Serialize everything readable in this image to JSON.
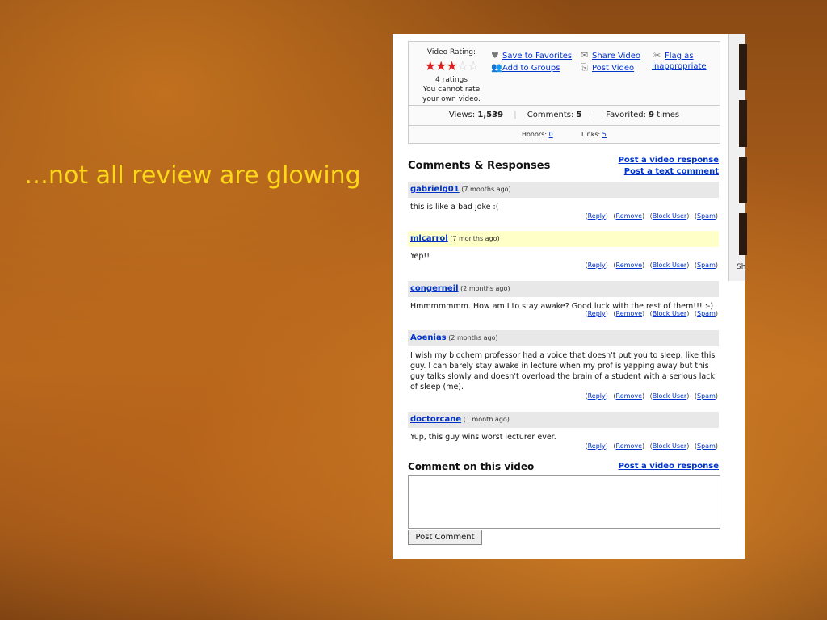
{
  "slide": {
    "caption": "…not all review are glowing"
  },
  "video_box": {
    "rating_label": "Video Rating:",
    "stars_filled": 3,
    "stars_total": 5,
    "ratings_count": "4 ratings",
    "rating_note": "You cannot rate your own video.",
    "actions": {
      "save_favorites": "Save to Favorites",
      "add_groups": "Add to Groups",
      "share_video": "Share Video",
      "post_video": "Post Video",
      "flag_as": "Flag as",
      "inappropriate": "Inappropriate"
    },
    "stats": {
      "views_label": "Views:",
      "views_value": "1,539",
      "comments_label": "Comments:",
      "comments_value": "5",
      "favorited_label": "Favorited:",
      "favorited_value": "9",
      "favorited_suffix": "times",
      "honors_label": "Honors:",
      "honors_value": "0",
      "links_label": "Links:",
      "links_value": "5"
    }
  },
  "comments_section": {
    "title": "Comments & Responses",
    "post_video_response": "Post a video response",
    "post_text_comment": "Post a text comment",
    "action_labels": {
      "reply": "Reply",
      "remove": "Remove",
      "block": "Block User",
      "spam": "Spam"
    },
    "comments": [
      {
        "user": "gabrielg01",
        "time": "(7 months ago)",
        "text": "this is like a bad joke :("
      },
      {
        "user": "mlcarrol",
        "time": "(7 months ago)",
        "text": "Yep!!"
      },
      {
        "user": "congerneil",
        "time": "(2 months ago)",
        "text": "Hmmmmmmm. How am I to stay awake? Good luck with the rest of them!!! :-)"
      },
      {
        "user": "Aoenias",
        "time": "(2 months ago)",
        "text": "I wish my biochem professor had a voice that doesn't put you to sleep, like this guy. I can barely stay awake in lecture when my prof is yapping away but this guy talks slowly and doesn't overload the brain of a student with a serious lack of sleep (me)."
      },
      {
        "user": "doctorcane",
        "time": "(1 month ago)",
        "text": "Yup, this guy wins worst lecturer ever."
      }
    ]
  },
  "comment_form": {
    "title": "Comment on this video",
    "post_video_response": "Post a video response",
    "submit_label": "Post Comment"
  },
  "sidebar": {
    "label_fragment": "Sh"
  }
}
